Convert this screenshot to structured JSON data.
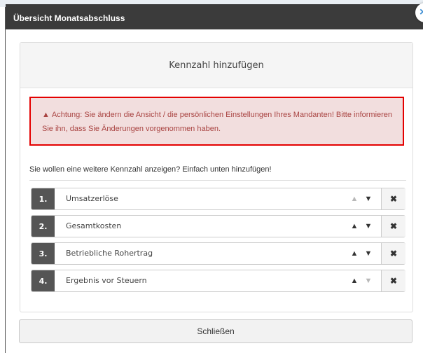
{
  "modal": {
    "title": "Übersicht Monatsabschluss",
    "close_icon": "close-icon",
    "close_glyph": "×"
  },
  "panel": {
    "heading": "Kennzahl hinzufügen",
    "alert": {
      "icon": "warning-icon",
      "glyph": "▲",
      "text": "Achtung: Sie ändern die Ansicht / die persönlichen Einstellungen Ihres Mandanten! Bitte informieren Sie ihn, dass Sie Änderungen vorgenommen haben.",
      "border_color": "#e40000"
    },
    "hint": "Sie wollen eine weitere Kennzahl anzeigen? Einfach unten hinzufügen!",
    "rows": [
      {
        "num": "1.",
        "label": "Umsatzerlöse",
        "up_enabled": false,
        "down_enabled": true
      },
      {
        "num": "2.",
        "label": "Gesamtkosten",
        "up_enabled": true,
        "down_enabled": true
      },
      {
        "num": "3.",
        "label": "Betriebliche Rohertrag",
        "up_enabled": true,
        "down_enabled": true
      },
      {
        "num": "4.",
        "label": "Ergebnis vor Steuern",
        "up_enabled": true,
        "down_enabled": false
      }
    ],
    "glyphs": {
      "up": "▲",
      "down": "▼",
      "remove": "✖"
    }
  },
  "footer": {
    "close_label": "Schließen"
  }
}
